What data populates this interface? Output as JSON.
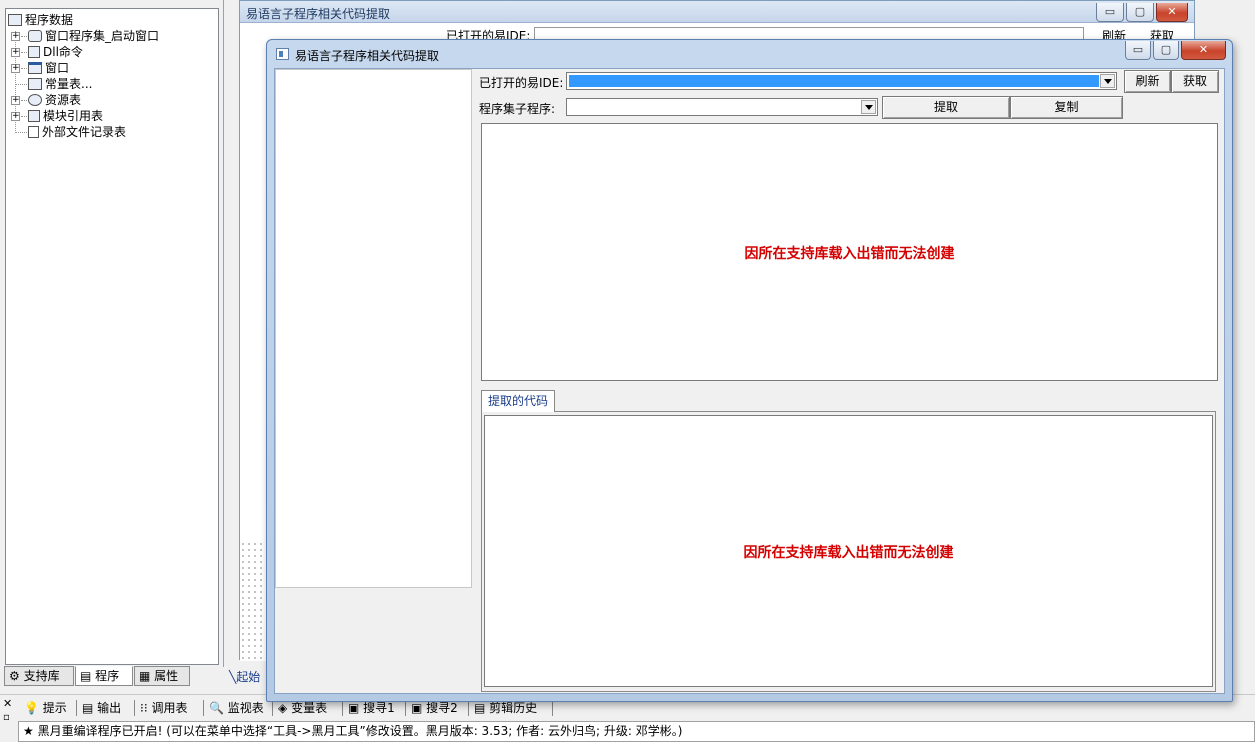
{
  "tree": {
    "root": "程序数据",
    "items": [
      {
        "label": "窗口程序集_启动窗口",
        "expandable": true,
        "icon": "assembly-icon"
      },
      {
        "label": "Dll命令",
        "expandable": true,
        "icon": "dll-icon"
      },
      {
        "label": "窗口",
        "expandable": true,
        "icon": "window-icon"
      },
      {
        "label": "常量表...",
        "expandable": false,
        "icon": "constant-icon"
      },
      {
        "label": "资源表",
        "expandable": true,
        "icon": "resource-icon"
      },
      {
        "label": "模块引用表",
        "expandable": true,
        "icon": "module-icon"
      },
      {
        "label": "外部文件记录表",
        "expandable": false,
        "icon": "file-icon"
      }
    ]
  },
  "left_tabs": [
    {
      "label": "支持库",
      "icon": "library-icon"
    },
    {
      "label": "程序",
      "icon": "program-icon"
    },
    {
      "label": "属性",
      "icon": "property-icon"
    }
  ],
  "bg_window": {
    "title": "易语言子程序相关代码提取",
    "ide_label": "已打开的易IDE:",
    "refresh": "刷新",
    "fetch": "获取",
    "start_tab": "起始"
  },
  "main_window": {
    "title": "易语言子程序相关代码提取",
    "ide_label": "已打开的易IDE:",
    "refresh_button": "刷新",
    "fetch_button": "获取",
    "subprogram_label": "程序集子程序:",
    "extract_button": "提取",
    "copy_button": "复制",
    "error_text_top": "因所在支持库载入出错而无法创建",
    "code_tab": "提取的代码",
    "error_text_bottom": "因所在支持库载入出错而无法创建"
  },
  "bottom_tabs": [
    {
      "label": "提示",
      "icon": "hint-icon"
    },
    {
      "label": "输出",
      "icon": "output-icon"
    },
    {
      "label": "调用表",
      "icon": "call-table-icon"
    },
    {
      "label": "监视表",
      "icon": "watch-icon"
    },
    {
      "label": "变量表",
      "icon": "variable-icon"
    },
    {
      "label": "搜寻1",
      "icon": "search1-icon"
    },
    {
      "label": "搜寻2",
      "icon": "search2-icon"
    },
    {
      "label": "剪辑历史",
      "icon": "clip-history-icon"
    }
  ],
  "output": {
    "message": "★ 黑月重编译程序已开启! (可以在菜单中选择“工具->黑月工具”修改设置。黑月版本: 3.53; 作者: 云外归鸟; 升级: 邓学彬。)"
  },
  "colors": {
    "error_red": "#d40000",
    "selection_blue": "#3399ff",
    "tab_text": "#1a3c8a"
  }
}
